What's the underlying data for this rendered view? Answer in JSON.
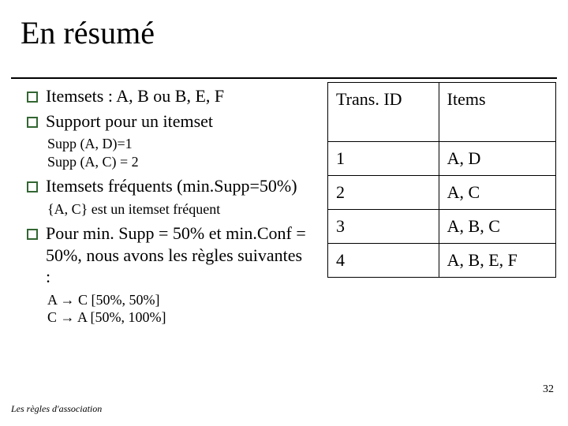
{
  "title": "En résumé",
  "bullets": {
    "b1": "Itemsets : A, B  ou B, E, F",
    "b2": "Support pour un itemset",
    "b2_sub1": "Supp (A, D)=1",
    "b2_sub2": "Supp (A, C) = 2",
    "b3": "Itemsets fréquents (min.Supp=50%)",
    "b3_sub1": "{A, C} est un itemset fréquent",
    "b4": " Pour min. Supp = 50% et min.Conf = 50%, nous avons les règles suivantes :",
    "b4_sub1": "A → C [50%, 50%]",
    "b4_sub2": "C → A [50%, 100%]"
  },
  "table": {
    "header": {
      "c1": "Trans. ID",
      "c2": "Items"
    },
    "rows": [
      {
        "c1": "1",
        "c2": "A, D"
      },
      {
        "c1": "2",
        "c2": "A, C"
      },
      {
        "c1": "3",
        "c2": "A, B, C"
      },
      {
        "c1": "4",
        "c2": "A, B, E, F"
      }
    ]
  },
  "footer": "Les règles d'association",
  "page_number": "32",
  "chart_data": {
    "type": "table",
    "title": "Transactions",
    "columns": [
      "Trans. ID",
      "Items"
    ],
    "rows": [
      [
        "1",
        "A, D"
      ],
      [
        "2",
        "A, C"
      ],
      [
        "3",
        "A, B, C"
      ],
      [
        "4",
        "A, B, E, F"
      ]
    ]
  }
}
